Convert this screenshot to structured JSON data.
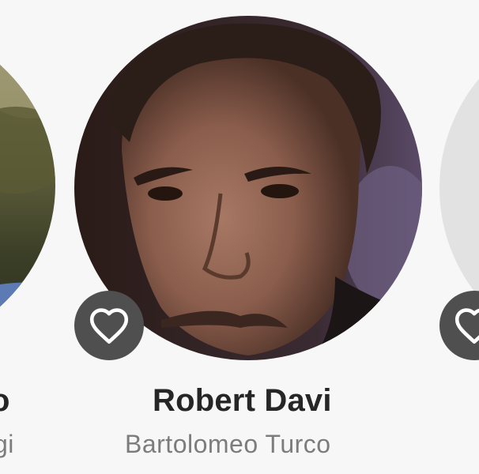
{
  "cast": [
    {
      "name": "o",
      "character": "gi",
      "favorite_icon": "heart-outline-icon"
    },
    {
      "name": "Robert Davi",
      "character": "Bartolomeo Turco",
      "favorite_icon": "heart-outline-icon"
    },
    {
      "name": "",
      "character": "",
      "favorite_icon": "heart-outline-icon"
    }
  ],
  "colors": {
    "background": "#f7f7f7",
    "name_text": "#262626",
    "character_text": "#7c7c7c",
    "favorite_button": "#4f4f4f",
    "placeholder_photo": "#e2e2e2"
  }
}
